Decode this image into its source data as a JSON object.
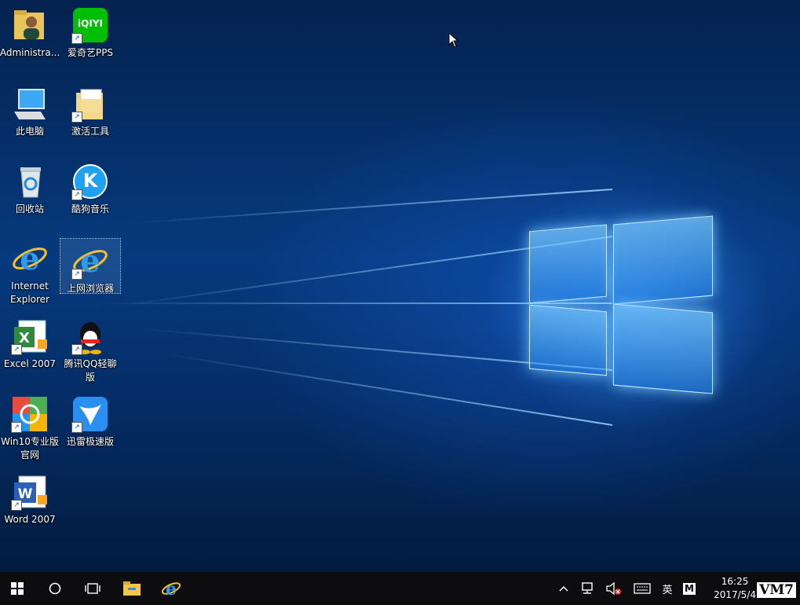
{
  "desktop": {
    "icons": [
      {
        "label": "Administra...",
        "icon": "user-folder-icon"
      },
      {
        "label": "爱奇艺PPS",
        "icon": "iqiyi-icon",
        "glyph_text": "iQIYI"
      },
      {
        "label": "此电脑",
        "icon": "computer-icon"
      },
      {
        "label": "激活工具",
        "icon": "folder-icon"
      },
      {
        "label": "回收站",
        "icon": "recycle-bin-icon"
      },
      {
        "label": "酷狗音乐",
        "icon": "kugou-icon",
        "glyph_text": "K"
      },
      {
        "label": "Internet Explorer",
        "icon": "ie-icon"
      },
      {
        "label": "上网浏览器",
        "icon": "ie-icon"
      },
      {
        "label": "Excel 2007",
        "icon": "excel-icon"
      },
      {
        "label": "腾讯QQ轻聊版",
        "icon": "qq-icon"
      },
      {
        "label": "Win10专业版官网",
        "icon": "win10-site-icon"
      },
      {
        "label": "迅雷极速版",
        "icon": "xunlei-icon"
      },
      {
        "label": "Word 2007",
        "icon": "word-icon"
      }
    ]
  },
  "taskbar": {
    "tray": {
      "ime_label": "英",
      "ime_mode": "M"
    },
    "clock": {
      "time": "16:25",
      "date": "2017/5/4"
    },
    "watermark": "VM7"
  },
  "colors": {
    "taskbar": "#0d0d10",
    "desktop_blue": "#063a7e",
    "accent": "#1e90ff"
  }
}
